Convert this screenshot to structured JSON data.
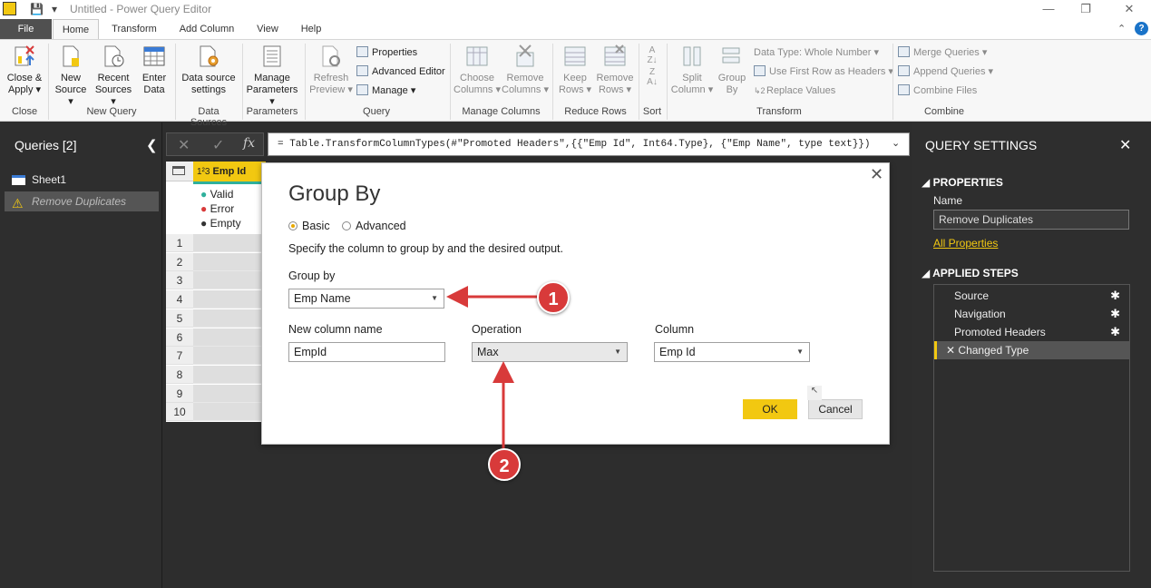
{
  "window": {
    "title": "Untitled - Power Query Editor"
  },
  "tabs": [
    {
      "label": "File"
    },
    {
      "label": "Home"
    },
    {
      "label": "Transform"
    },
    {
      "label": "Add Column"
    },
    {
      "label": "View"
    },
    {
      "label": "Help"
    }
  ],
  "ribbon": {
    "close_apply": {
      "line1": "Close &",
      "line2": "Apply"
    },
    "new_source": {
      "line1": "New",
      "line2": "Source"
    },
    "recent_sources": {
      "line1": "Recent",
      "line2": "Sources"
    },
    "enter_data": {
      "line1": "Enter",
      "line2": "Data"
    },
    "data_source_settings": {
      "line1": "Data source",
      "line2": "settings"
    },
    "manage_parameters": {
      "line1": "Manage",
      "line2": "Parameters"
    },
    "refresh_preview": {
      "line1": "Refresh",
      "line2": "Preview"
    },
    "properties": "Properties",
    "advanced_editor": "Advanced Editor",
    "manage": "Manage",
    "choose_columns": {
      "line1": "Choose",
      "line2": "Columns"
    },
    "remove_columns": {
      "line1": "Remove",
      "line2": "Columns"
    },
    "keep_rows": {
      "line1": "Keep",
      "line2": "Rows"
    },
    "remove_rows": {
      "line1": "Remove",
      "line2": "Rows"
    },
    "split_column": {
      "line1": "Split",
      "line2": "Column"
    },
    "group_by": {
      "line1": "Group",
      "line2": "By"
    },
    "data_type": "Data Type: Whole Number",
    "use_first_row": "Use First Row as Headers",
    "replace_values": "Replace Values",
    "merge_queries": "Merge Queries",
    "append_queries": "Append Queries",
    "combine_files": "Combine Files",
    "groups": {
      "close": "Close",
      "new_query": "New Query",
      "data_sources": "Data Sources",
      "parameters": "Parameters",
      "query": "Query",
      "manage_columns": "Manage Columns",
      "reduce_rows": "Reduce Rows",
      "sort": "Sort",
      "transform": "Transform",
      "combine": "Combine"
    }
  },
  "queries_pane": {
    "header": "Queries [2]",
    "items": [
      {
        "label": "Sheet1"
      },
      {
        "label": "Remove Duplicates"
      }
    ]
  },
  "formula_bar": {
    "fx": "fx",
    "formula": "= Table.TransformColumnTypes(#\"Promoted Headers\",{{\"Emp Id\", Int64.Type}, {\"Emp Name\", type text}})"
  },
  "grid": {
    "column_header": "Emp Id",
    "type_label": "1²3",
    "quality": [
      "Valid",
      "Error",
      "Empty"
    ],
    "rows": [
      "1",
      "2",
      "3",
      "4",
      "5",
      "6",
      "7",
      "8",
      "9",
      "10"
    ]
  },
  "query_settings": {
    "header": "QUERY SETTINGS",
    "properties_header": "PROPERTIES",
    "name_label": "Name",
    "name_value": "Remove Duplicates",
    "all_properties": "All Properties",
    "applied_steps_header": "APPLIED STEPS",
    "steps": [
      {
        "label": "Source"
      },
      {
        "label": "Navigation"
      },
      {
        "label": "Promoted Headers"
      },
      {
        "label": "Changed Type"
      }
    ]
  },
  "dialog": {
    "title": "Group By",
    "radio_basic": "Basic",
    "radio_advanced": "Advanced",
    "description": "Specify the column to group by and the desired output.",
    "group_by_label": "Group by",
    "group_by_value": "Emp Name",
    "new_column_label": "New column name",
    "new_column_value": "EmpId",
    "operation_label": "Operation",
    "operation_value": "Max",
    "column_label": "Column",
    "column_value": "Emp Id",
    "ok": "OK",
    "cancel": "Cancel"
  },
  "annotations": {
    "badge1": "1",
    "badge2": "2",
    "color": "#d83a3a"
  },
  "colors": {
    "accent": "#f2c811",
    "pane_bg": "#2e2e2e"
  }
}
